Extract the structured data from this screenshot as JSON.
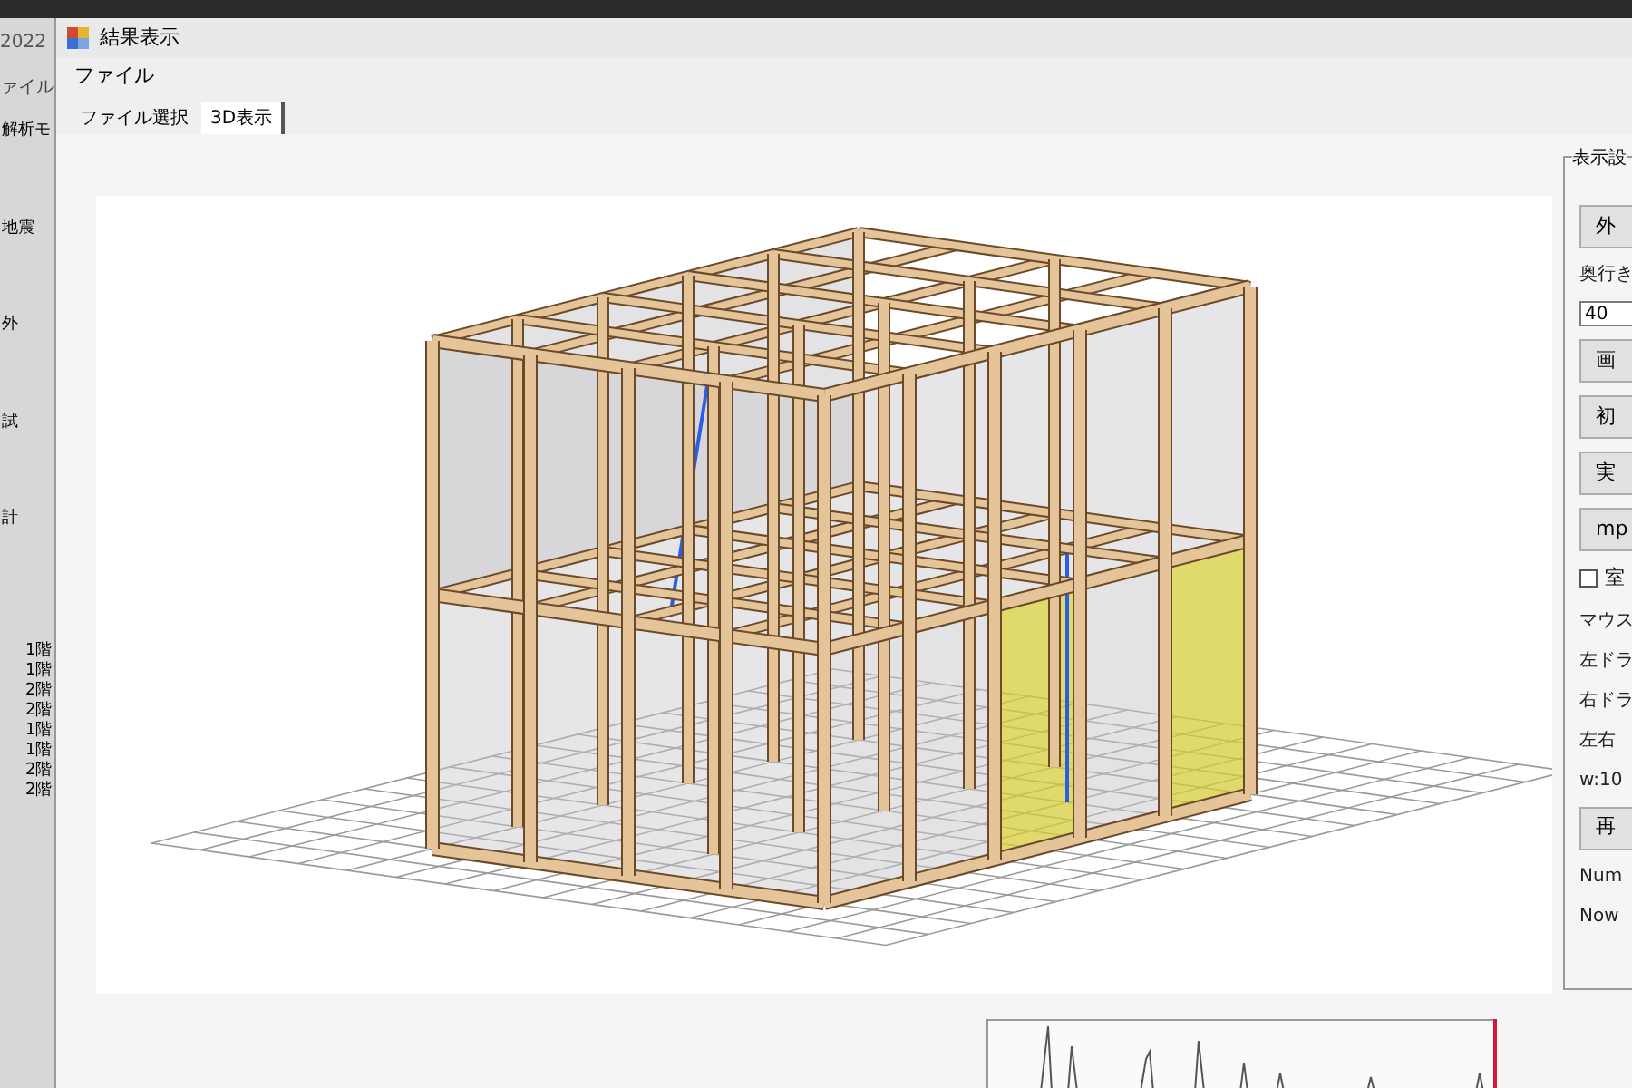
{
  "back_window": {
    "title": "2022",
    "menu": "ァイル",
    "items": [
      "解析モ",
      "地震",
      "外",
      "試",
      "計"
    ],
    "rows": [
      "1階",
      "1階",
      "2階",
      "2階",
      "1階",
      "1階",
      "2階",
      "2階"
    ]
  },
  "window": {
    "title": "結果表示"
  },
  "menu": [
    "ファイル"
  ],
  "tabs": [
    {
      "label": "ファイル選択",
      "selected": false
    },
    {
      "label": "3D表示",
      "selected": true
    }
  ],
  "settings": {
    "title": "表示設",
    "items": [
      {
        "kind": "button",
        "label": "外"
      },
      {
        "kind": "label",
        "label": "奥行き"
      },
      {
        "kind": "input",
        "value": "40"
      },
      {
        "kind": "button",
        "label": "画"
      },
      {
        "kind": "button",
        "label": "初"
      },
      {
        "kind": "button",
        "label": "実"
      },
      {
        "kind": "button",
        "label": "mp"
      },
      {
        "kind": "checkbox",
        "label": "室",
        "checked": false
      },
      {
        "kind": "label",
        "label": "マウス"
      },
      {
        "kind": "label",
        "label": "左ドラ"
      },
      {
        "kind": "label",
        "label": "右ドラ"
      },
      {
        "kind": "label",
        "label": "左右"
      },
      {
        "kind": "label",
        "label": "w:10"
      },
      {
        "kind": "button",
        "label": "再"
      },
      {
        "kind": "label",
        "label": "Num"
      },
      {
        "kind": "label",
        "label": "Now"
      }
    ]
  }
}
